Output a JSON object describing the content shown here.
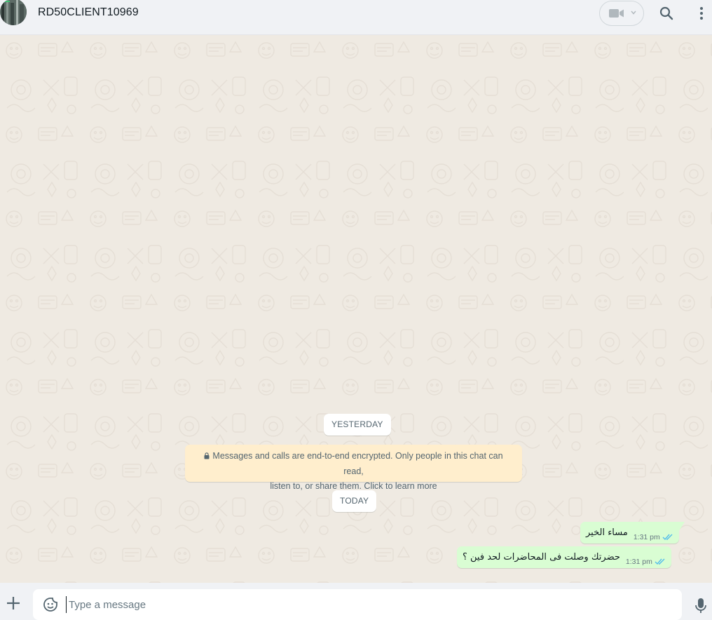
{
  "header": {
    "contact_name": "RD50CLIENT10969",
    "avatar_icon": "contact-avatar",
    "video_call_icon": "video-camera-icon",
    "dropdown_icon": "chevron-down-icon",
    "search_icon": "search-icon",
    "menu_icon": "vertical-dots-icon"
  },
  "chat": {
    "date_chips": [
      "YESTERDAY",
      "TODAY"
    ],
    "encryption_notice": {
      "icon": "lock-icon",
      "line1": "Messages and calls are end-to-end encrypted. Only people in this chat can read,",
      "line2": "listen to, or share them. Click to learn more"
    },
    "messages": [
      {
        "text": "مساء الخير",
        "time": "1:31 pm",
        "status": "read"
      },
      {
        "text": "حضرتك وصلت فى المحاضرات لحد فين ؟",
        "time": "1:31 pm",
        "status": "read"
      }
    ]
  },
  "composer": {
    "placeholder": "Type a message",
    "attach_icon": "plus-icon",
    "emoji_icon": "sticker-smiley-icon",
    "mic_icon": "microphone-icon"
  },
  "colors": {
    "header_bg": "#f0f2f5",
    "chat_bg": "#efeae2",
    "outgoing_bubble": "#d9fdd3",
    "notice_bg": "#ffeecd",
    "read_tick": "#53bdeb"
  }
}
